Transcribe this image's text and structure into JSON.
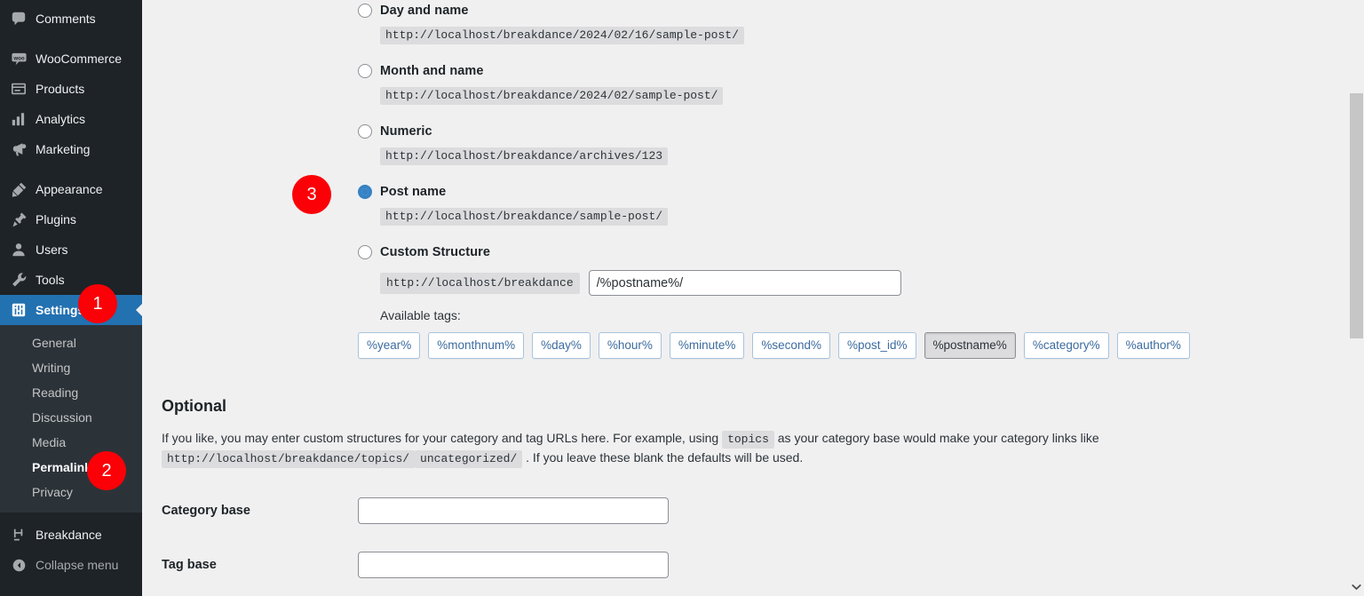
{
  "sidebar": {
    "items": [
      {
        "label": "Comments",
        "icon": "comments-icon"
      },
      {
        "label": "WooCommerce",
        "icon": "woocommerce-icon"
      },
      {
        "label": "Products",
        "icon": "products-icon"
      },
      {
        "label": "Analytics",
        "icon": "analytics-icon"
      },
      {
        "label": "Marketing",
        "icon": "marketing-megaphone-icon"
      },
      {
        "label": "Appearance",
        "icon": "appearance-brush-icon"
      },
      {
        "label": "Plugins",
        "icon": "plugins-plug-icon"
      },
      {
        "label": "Users",
        "icon": "users-icon"
      },
      {
        "label": "Tools",
        "icon": "tools-wrench-icon"
      },
      {
        "label": "Settings",
        "icon": "settings-sliders-icon"
      }
    ],
    "submenu": [
      {
        "label": "General"
      },
      {
        "label": "Writing"
      },
      {
        "label": "Reading"
      },
      {
        "label": "Discussion"
      },
      {
        "label": "Media"
      },
      {
        "label": "Permalinks"
      },
      {
        "label": "Privacy"
      }
    ],
    "footer": [
      {
        "label": "Breakdance",
        "icon": "breakdance-icon"
      },
      {
        "label": "Collapse menu",
        "icon": "collapse-arrow-icon"
      }
    ],
    "colors": {
      "background": "#1d2327",
      "submenu_background": "#2c3338",
      "active": "#2271b1"
    }
  },
  "permalinks": {
    "options": [
      {
        "label": "Day and name",
        "example": "http://localhost/breakdance/2024/02/16/sample-post/",
        "selected": false
      },
      {
        "label": "Month and name",
        "example": "http://localhost/breakdance/2024/02/sample-post/",
        "selected": false
      },
      {
        "label": "Numeric",
        "example": "http://localhost/breakdance/archives/123",
        "selected": false
      },
      {
        "label": "Post name",
        "example": "http://localhost/breakdance/sample-post/",
        "selected": true
      }
    ],
    "custom": {
      "label": "Custom Structure",
      "selected": false,
      "prefix": "http://localhost/breakdance",
      "value": "/%postname%/"
    },
    "available_tags_label": "Available tags:",
    "tags": [
      {
        "label": "%year%",
        "active": false
      },
      {
        "label": "%monthnum%",
        "active": false
      },
      {
        "label": "%day%",
        "active": false
      },
      {
        "label": "%hour%",
        "active": false
      },
      {
        "label": "%minute%",
        "active": false
      },
      {
        "label": "%second%",
        "active": false
      },
      {
        "label": "%post_id%",
        "active": false
      },
      {
        "label": "%postname%",
        "active": true
      },
      {
        "label": "%category%",
        "active": false
      },
      {
        "label": "%author%",
        "active": false
      }
    ]
  },
  "optional": {
    "title": "Optional",
    "desc_part1": "If you like, you may enter custom structures for your category and tag URLs here. For example, using",
    "desc_code1": "topics",
    "desc_part2": "as your category base would make your category links like",
    "desc_code2": "http://localhost/breakdance/topics/",
    "desc_code3": "uncategorized/",
    "desc_part3": ". If you leave these blank the defaults will be used.",
    "fields": [
      {
        "label": "Category base",
        "value": "",
        "placeholder": ""
      },
      {
        "label": "Tag base",
        "value": "",
        "placeholder": ""
      }
    ]
  },
  "annotations": {
    "badges": [
      {
        "number": "1"
      },
      {
        "number": "2"
      },
      {
        "number": "3"
      }
    ],
    "color": "#fb0007"
  },
  "scrollbar": {
    "position_hint": "near-top"
  }
}
